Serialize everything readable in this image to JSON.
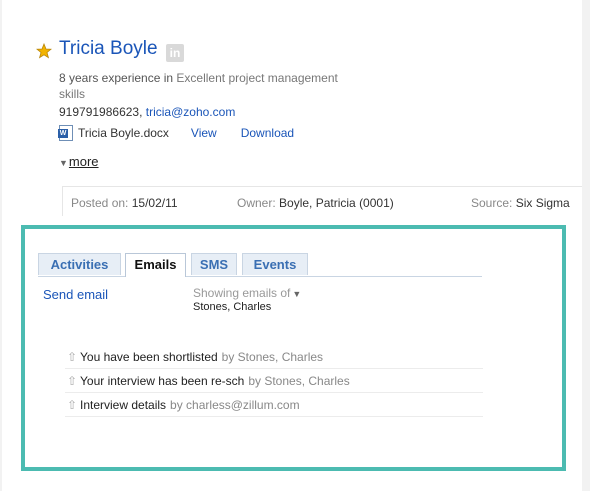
{
  "candidate": {
    "name": "Tricia Boyle",
    "linkedin_label": "in",
    "experience_text": "8 years experience in",
    "skill_text": "Excellent project management skills",
    "phone": "919791986623,",
    "email": "tricia@zoho.com",
    "resume_file": "Tricia Boyle.docx",
    "view_label": "View",
    "download_label": "Download",
    "more_label": "more"
  },
  "info": {
    "posted_label": "Posted on:",
    "posted_value": "15/02/11",
    "owner_label": "Owner:",
    "owner_value": "Boyle, Patricia (0001)",
    "source_label": "Source:",
    "source_value": "Six Sigma"
  },
  "tabs": [
    {
      "label": "Activities"
    },
    {
      "label": "Emails"
    },
    {
      "label": "SMS"
    },
    {
      "label": "Events"
    }
  ],
  "emails_panel": {
    "send_email_label": "Send email",
    "showing_label": "Showing emails of",
    "showing_person": "Stones, Charles",
    "items": [
      {
        "subject": "You have been shortlisted",
        "by": "by Stones, Charles"
      },
      {
        "subject": "Your interview has been re-sch",
        "by": "by Stones, Charles"
      },
      {
        "subject": "Interview details",
        "by": "by charless@zillum.com"
      }
    ]
  },
  "colors": {
    "link": "#1a55b8",
    "highlight_frame": "#4cbbb1",
    "star": "#f2b300"
  },
  "icons": [
    "star-icon",
    "linkedin-icon",
    "word-doc-icon",
    "triangle-down-icon",
    "reply-arrow-icon"
  ]
}
